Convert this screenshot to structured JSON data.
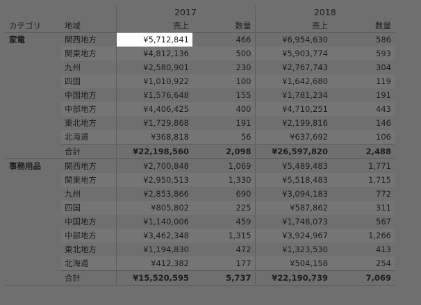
{
  "headers": {
    "category": "カテゴリ",
    "region": "地域",
    "sales": "売上",
    "qty": "数量",
    "years": [
      "2017",
      "2018"
    ]
  },
  "groups": [
    {
      "category": "家電",
      "rows": [
        {
          "region": "関西地方",
          "s2017": "¥5,712,841",
          "q2017": "466",
          "s2018": "¥6,954,630",
          "q2018": "586",
          "selected": true
        },
        {
          "region": "関東地方",
          "s2017": "¥4,812,136",
          "q2017": "500",
          "s2018": "¥5,903,774",
          "q2018": "593"
        },
        {
          "region": "九州",
          "s2017": "¥2,580,901",
          "q2017": "230",
          "s2018": "¥2,767,743",
          "q2018": "304"
        },
        {
          "region": "四国",
          "s2017": "¥1,010,922",
          "q2017": "100",
          "s2018": "¥1,642,680",
          "q2018": "119"
        },
        {
          "region": "中国地方",
          "s2017": "¥1,576,648",
          "q2017": "155",
          "s2018": "¥1,781,234",
          "q2018": "191"
        },
        {
          "region": "中部地方",
          "s2017": "¥4,406,425",
          "q2017": "400",
          "s2018": "¥4,710,251",
          "q2018": "443"
        },
        {
          "region": "東北地方",
          "s2017": "¥1,729,868",
          "q2017": "191",
          "s2018": "¥2,199,816",
          "q2018": "146"
        },
        {
          "region": "北海道",
          "s2017": "¥368,818",
          "q2017": "56",
          "s2018": "¥637,692",
          "q2018": "106"
        }
      ],
      "total": {
        "region": "合計",
        "s2017": "¥22,198,560",
        "q2017": "2,098",
        "s2018": "¥26,597,820",
        "q2018": "2,488"
      }
    },
    {
      "category": "事務用品",
      "rows": [
        {
          "region": "関西地方",
          "s2017": "¥2,700,848",
          "q2017": "1,069",
          "s2018": "¥5,489,483",
          "q2018": "1,771"
        },
        {
          "region": "関東地方",
          "s2017": "¥2,950,513",
          "q2017": "1,330",
          "s2018": "¥5,518,483",
          "q2018": "1,715"
        },
        {
          "region": "九州",
          "s2017": "¥2,853,866",
          "q2017": "690",
          "s2018": "¥3,094,183",
          "q2018": "772"
        },
        {
          "region": "四国",
          "s2017": "¥805,802",
          "q2017": "225",
          "s2018": "¥587,862",
          "q2018": "311"
        },
        {
          "region": "中国地方",
          "s2017": "¥1,140,006",
          "q2017": "459",
          "s2018": "¥1,748,073",
          "q2018": "567"
        },
        {
          "region": "中部地方",
          "s2017": "¥3,462,348",
          "q2017": "1,315",
          "s2018": "¥3,924,967",
          "q2018": "1,266"
        },
        {
          "region": "東北地方",
          "s2017": "¥1,194,830",
          "q2017": "472",
          "s2018": "¥1,323,530",
          "q2018": "413"
        },
        {
          "region": "北海道",
          "s2017": "¥412,382",
          "q2017": "177",
          "s2018": "¥504,158",
          "q2018": "254"
        }
      ],
      "total": {
        "region": "合計",
        "s2017": "¥15,520,595",
        "q2017": "5,737",
        "s2018": "¥22,190,739",
        "q2018": "7,069"
      }
    }
  ]
}
